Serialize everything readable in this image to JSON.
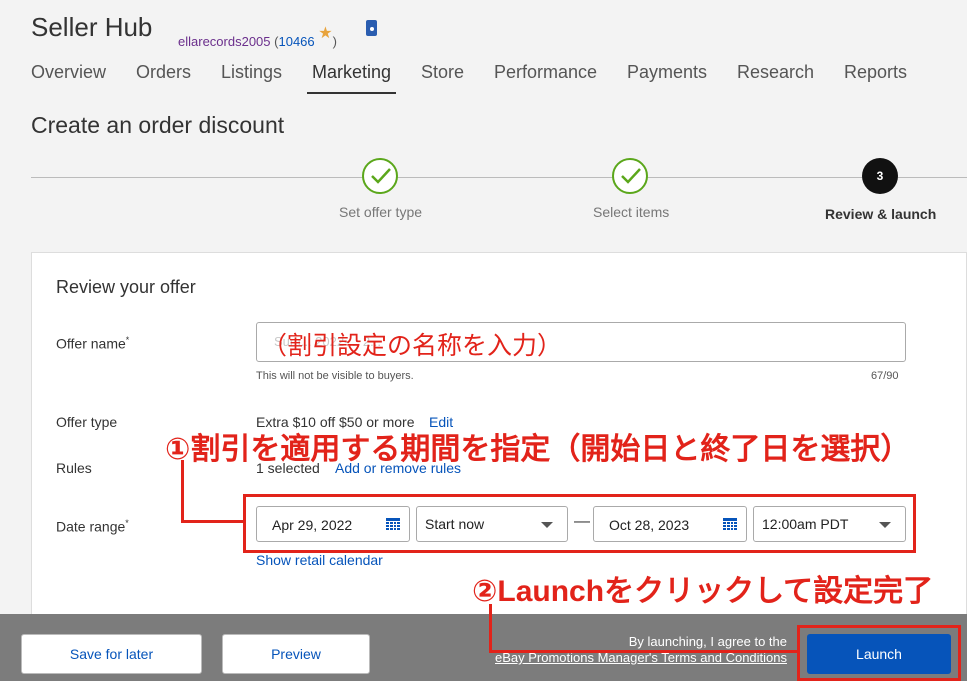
{
  "header": {
    "app_title": "Seller Hub",
    "username": "ellarecords2005",
    "feedback_open": "(",
    "feedback_score": "10466",
    "feedback_close": ")"
  },
  "nav": {
    "items": [
      "Overview",
      "Orders",
      "Listings",
      "Marketing",
      "Store",
      "Performance",
      "Payments",
      "Research",
      "Reports"
    ],
    "active": "Marketing"
  },
  "page": {
    "title": "Create an order discount"
  },
  "steps": [
    {
      "label": "Set offer type",
      "state": "done"
    },
    {
      "label": "Select items",
      "state": "done"
    },
    {
      "number": "3",
      "label": "Review & launch",
      "state": "current"
    }
  ],
  "form": {
    "heading": "Review your offer",
    "offer_name_label": "Offer name",
    "required_mark": "*",
    "offer_name_value": "Sum... 2022-... 2...",
    "offer_name_hint": "This will not be visible to buyers.",
    "offer_name_counter": "67/90",
    "offer_type_label": "Offer type",
    "offer_type_value": "Extra $10 off $50 or more",
    "offer_type_edit": "Edit",
    "rules_label": "Rules",
    "rules_value": "1 selected",
    "rules_link": "Add or remove rules",
    "date_range_label": "Date range",
    "start_date": "Apr 29, 2022",
    "start_time": "Start now",
    "range_separator": "—",
    "end_date": "Oct 28, 2023",
    "end_time": "12:00am PDT",
    "calendar_link": "Show retail calendar"
  },
  "annotations": {
    "name_note": "（割引設定の名称を入力）",
    "step1": "①割引を適用する期間を指定（開始日と終了日を選択）",
    "step2": "②Launchをクリックして設定完了"
  },
  "footer": {
    "save_later": "Save for later",
    "preview": "Preview",
    "agree_text": "By launching, I agree to the",
    "agree_link": "eBay Promotions Manager's Terms and Conditions",
    "launch": "Launch"
  },
  "colors": {
    "annotation_red": "#e2231a",
    "link_blue": "#0654ba",
    "check_green": "#5ba71b",
    "footer_gray": "#7c7c7c"
  },
  "icons": [
    "star-icon",
    "seller-badge-icon",
    "checkmark-icon",
    "calendar-icon",
    "chevron-down-icon"
  ]
}
